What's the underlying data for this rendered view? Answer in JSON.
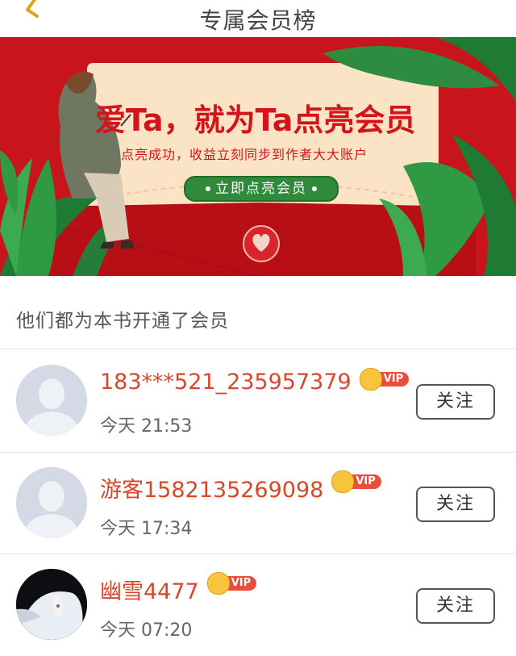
{
  "header": {
    "title": "专属会员榜",
    "back_icon": "chevron-left-icon"
  },
  "banner": {
    "headline": "爱Ta，就为Ta点亮会员",
    "subtitle": "点亮成功，收益立刻同步到作者大大账户",
    "cta_label": "立即点亮会员",
    "colors": {
      "background": "#c8141b",
      "card": "#fbe3c6",
      "button": "#2f8a3b"
    }
  },
  "section": {
    "title": "他们都为本书开通了会员"
  },
  "members": [
    {
      "name": "183***521_235957379",
      "badge": "VIP",
      "time": "今天 21:53",
      "follow_label": "关注",
      "avatar": "default-avatar"
    },
    {
      "name": "游客1582135269098",
      "badge": "VIP",
      "time": "今天 17:34",
      "follow_label": "关注",
      "avatar": "default-avatar"
    },
    {
      "name": "幽雪4477",
      "badge": "VIP",
      "time": "今天 07:20",
      "follow_label": "关注",
      "avatar": "anime-avatar"
    }
  ],
  "colors": {
    "username": "#d9472a",
    "vip_tag": "#ea4d3c",
    "crown": "#f7c43c"
  }
}
